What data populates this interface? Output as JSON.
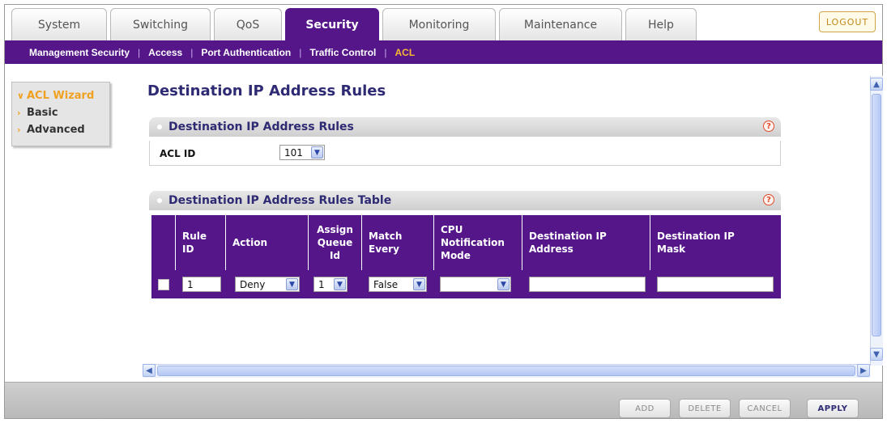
{
  "nav": {
    "tabs": [
      {
        "label": "System"
      },
      {
        "label": "Switching"
      },
      {
        "label": "QoS"
      },
      {
        "label": "Security"
      },
      {
        "label": "Monitoring"
      },
      {
        "label": "Maintenance"
      },
      {
        "label": "Help"
      }
    ],
    "active_tab": "Security",
    "logout_label": "LOGOUT"
  },
  "subnav": {
    "items": [
      {
        "label": "Management Security"
      },
      {
        "label": "Access"
      },
      {
        "label": "Port Authentication"
      },
      {
        "label": "Traffic Control"
      },
      {
        "label": "ACL"
      }
    ],
    "separator": "|",
    "active": "ACL"
  },
  "sidebar": {
    "items": [
      {
        "label": "ACL Wizard",
        "active": true
      },
      {
        "label": "Basic"
      },
      {
        "label": "Advanced"
      }
    ]
  },
  "page": {
    "title": "Destination IP Address Rules"
  },
  "acl_section": {
    "title": "Destination IP Address Rules",
    "acl_id_label": "ACL ID",
    "acl_id_value": "101"
  },
  "rules_section": {
    "title": "Destination IP Address Rules Table",
    "columns": [
      {
        "label": ""
      },
      {
        "label": "Rule\nID"
      },
      {
        "label": "Action"
      },
      {
        "label": "Assign\nQueue\nId"
      },
      {
        "label": "Match\nEvery"
      },
      {
        "label": "CPU\nNotification\nMode"
      },
      {
        "label": "Destination IP\nAddress"
      },
      {
        "label": "Destination IP\nMask"
      }
    ],
    "row": {
      "rule_id": "1",
      "action": "Deny",
      "queue_id": "1",
      "match_every": "False",
      "cpu_mode": "",
      "dest_ip": "",
      "dest_mask": ""
    }
  },
  "footer": {
    "add": "ADD",
    "delete": "DELETE",
    "cancel": "CANCEL",
    "apply": "APPLY"
  },
  "colors": {
    "brand_purple": "#55168a",
    "accent_orange": "#f0a11f",
    "title_navy": "#2e2a73"
  },
  "icons": [
    "help-icon",
    "dropdown-arrow-icon",
    "scroll-up-icon",
    "scroll-down-icon",
    "scroll-left-icon",
    "scroll-right-icon"
  ]
}
